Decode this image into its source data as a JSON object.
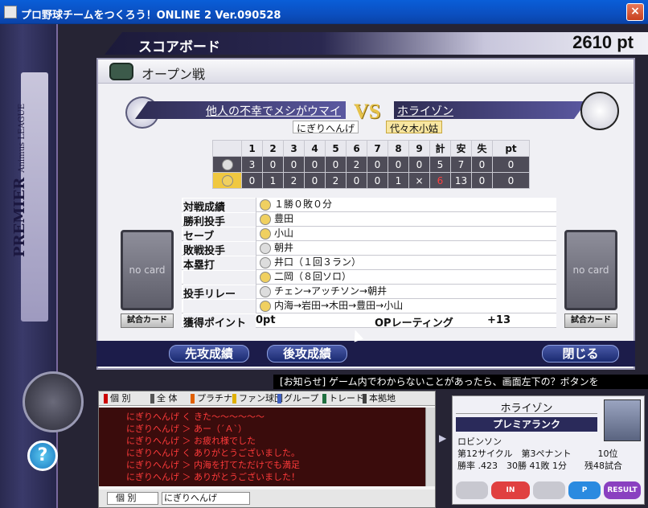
{
  "window": {
    "title": "プロ野球チームをつくろう！ONLINE 2 Ver.090528",
    "close": "×"
  },
  "sidebar": {
    "league": "PREMIER",
    "league_sub": "Animus LEAGUE"
  },
  "header": {
    "section": "スコアボード",
    "points": "2610 pt"
  },
  "panel": {
    "title": "オープン戦"
  },
  "matchup": {
    "home_team": "他人の不幸でメシがウマイ",
    "home_owner": "にぎりへんげ",
    "vs": "VS",
    "away_team": "ホライゾン",
    "away_owner": "代々木小姑"
  },
  "linescore": {
    "headers": [
      "1",
      "2",
      "3",
      "4",
      "5",
      "6",
      "7",
      "8",
      "9",
      "計",
      "安",
      "失",
      "pt"
    ],
    "rows": [
      {
        "team": "visitor",
        "cells": [
          "3",
          "0",
          "0",
          "0",
          "0",
          "2",
          "0",
          "0",
          "0",
          "5",
          "7",
          "0",
          "0"
        ]
      },
      {
        "team": "home",
        "cells": [
          "0",
          "1",
          "2",
          "0",
          "2",
          "0",
          "0",
          "1",
          "×",
          "6",
          "13",
          "0",
          "0"
        ]
      }
    ]
  },
  "details": {
    "rows": [
      {
        "label": "対戦成績",
        "value": "１勝０敗０分"
      },
      {
        "label": "勝利投手",
        "value": "豊田"
      },
      {
        "label": "セーブ",
        "value": "小山"
      },
      {
        "label": "敗戦投手",
        "value": "朝井"
      },
      {
        "label": "本塁打",
        "value": "井口（１回３ラン）"
      },
      {
        "label": "",
        "value": "二岡（８回ソロ）"
      },
      {
        "label": "投手リレー",
        "value": "チェン→アッチソン→朝井"
      },
      {
        "label": "",
        "value": "内海→岩田→木田→豊田→小山"
      }
    ],
    "points_label": "獲得ポイント",
    "points_value": "0pt",
    "rating_label": "OPレーティング",
    "rating_value": "+13"
  },
  "cards": {
    "no_card": "no card",
    "button": "試合カード"
  },
  "nav": {
    "prev": "先攻成績",
    "next": "後攻成績",
    "close": "閉じる"
  },
  "notice": "[お知らせ] ゲーム内でわからないことがあったら、画面左下の？ボタンを",
  "chat": {
    "tabs": [
      "個 別",
      "全 体",
      "プラチナ",
      "ファン球団",
      "グループ",
      "トレード",
      "本拠地"
    ],
    "lines": [
      "にぎりへんげ く きた～～～～～～",
      "にぎりへんげ ＞ あー（´Ａ`）",
      "にぎりへんげ ＞ お疲れ様でした",
      "にぎりへんげ く ありがとうございました。",
      "にぎりへんげ ＞ 内海を打てただけでも満足",
      "にぎりへんげ ＞ ありがとうございました！"
    ],
    "input_mode": "個 別",
    "input_name": "にぎりへんげ"
  },
  "info": {
    "team": "ホライゾン",
    "rank": "プレミアランク",
    "owner": "ロビンソン",
    "line2": "第12サイクル　第3ペナント　　　10位",
    "line3": "勝率 .423　30勝 41敗 1分　　残48試合",
    "buttons": [
      "",
      "IN",
      "",
      "P",
      "RESULT"
    ]
  }
}
